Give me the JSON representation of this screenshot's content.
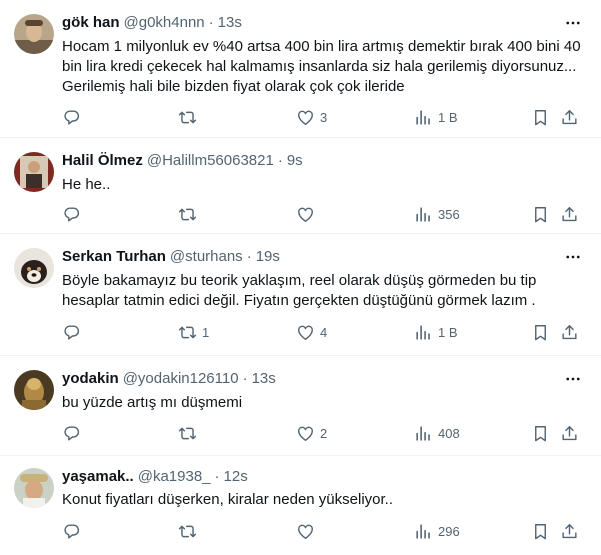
{
  "tweets": [
    {
      "name": "gök han",
      "handle": "@g0kh4nnn",
      "time": "13s",
      "text": "Hocam 1 milyonluk ev %40 artsa 400 bin lira artmış demektir bırak 400 bini 40 bin lira kredi çekecek hal kalmamış insanlarda siz hala gerilemiş diyorsunuz... Gerilemiş hali bile bizden fiyat olarak çok çok ileride",
      "replies": "",
      "retweets": "",
      "likes": "3",
      "views": "1 B"
    },
    {
      "name": "Halil Ölmez",
      "handle": "@Halillm56063821",
      "time": "9s",
      "text": "He he..",
      "replies": "",
      "retweets": "",
      "likes": "",
      "views": "356"
    },
    {
      "name": "Serkan Turhan",
      "handle": "@sturhans",
      "time": "19s",
      "text": "Böyle bakamayız bu teorik yaklaşım, reel olarak düşüş görmeden bu tip hesaplar tatmin edici değil.  Fiyatın gerçekten düştüğünü görmek lazım .",
      "replies": "",
      "retweets": "1",
      "likes": "4",
      "views": "1 B"
    },
    {
      "name": "yodakin",
      "handle": "@yodakin126110",
      "time": "13s",
      "text": "bu yüzde artış mı düşmemi",
      "replies": "",
      "retweets": "",
      "likes": "2",
      "views": "408"
    },
    {
      "name": "yaşamak..",
      "handle": "@ka1938_",
      "time": "12s",
      "text": "Konut fiyatları düşerken, kiralar neden yükseliyor..",
      "replies": "",
      "retweets": "",
      "likes": "",
      "views": "296"
    }
  ],
  "icons": {
    "more": "more-horizontal-icon",
    "reply": "reply-icon",
    "retweet": "retweet-icon",
    "like": "heart-icon",
    "views": "views-chart-icon",
    "bookmark": "bookmark-icon",
    "share": "share-icon"
  },
  "colors": {
    "text": "#0f1419",
    "secondary": "#536471",
    "divider": "#eff3f4"
  }
}
